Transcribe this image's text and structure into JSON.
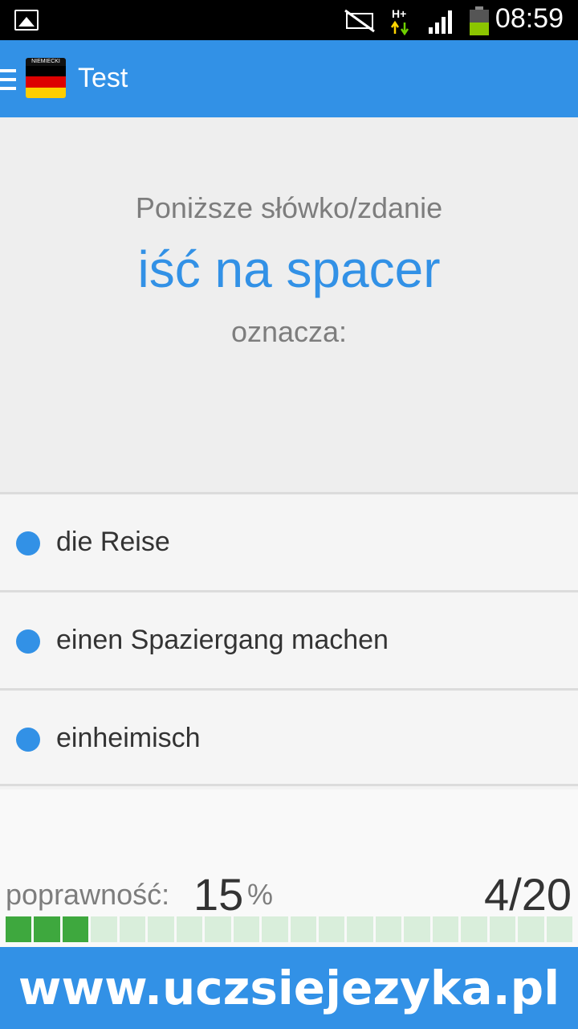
{
  "status_bar": {
    "time": "08:59",
    "network_label": "H+",
    "icons": [
      "image-icon",
      "silent-mode-icon",
      "network-hplus-icon",
      "signal-icon",
      "battery-icon"
    ]
  },
  "app_bar": {
    "title": "Test",
    "logo_text": "NIEMIECKI",
    "color": "#3291e6"
  },
  "question": {
    "intro": "Poniższe słówko/zdanie",
    "word": "iść na spacer",
    "suffix": "oznacza:"
  },
  "answers": [
    {
      "label": "die Reise"
    },
    {
      "label": "einen Spaziergang machen"
    },
    {
      "label": "einheimisch"
    }
  ],
  "stats": {
    "accuracy_label": "poprawność:",
    "accuracy_value": "15",
    "accuracy_unit": "%",
    "progress": "4/20",
    "segments_total": 20,
    "segments_done": 3
  },
  "banner": {
    "text": "www.uczsiejezyka.pl"
  },
  "colors": {
    "accent": "#3291e6",
    "progress_done": "#3ea83e",
    "progress_empty": "#d9eedb"
  }
}
